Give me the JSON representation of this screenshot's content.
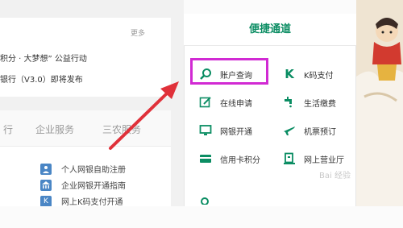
{
  "notice": {
    "more": "更多",
    "line1": "积分 · 大梦想” 公益行动",
    "line2": "银行（V3.0）即将发布"
  },
  "tabs": [
    "行",
    "企业服务",
    "三农服务"
  ],
  "services": [
    {
      "icon": "user-icon",
      "label": "个人网银自助注册"
    },
    {
      "icon": "bank-icon",
      "label": "企业网银开通指南"
    },
    {
      "icon": "k-icon",
      "label": "网上K码支付开通"
    }
  ],
  "quick": {
    "title": "便捷通道",
    "items": [
      {
        "icon": "search-icon",
        "label": "账户查询"
      },
      {
        "icon": "k-icon",
        "label": "K码支付"
      },
      {
        "icon": "edit-icon",
        "label": "在线申请"
      },
      {
        "icon": "faucet-icon",
        "label": "生活缴费"
      },
      {
        "icon": "monitor-icon",
        "label": "网银开通"
      },
      {
        "icon": "plane-icon",
        "label": "机票预订"
      },
      {
        "icon": "card-icon",
        "label": "信用卡积分"
      },
      {
        "icon": "office-icon",
        "label": "网上营业厅"
      }
    ]
  },
  "colors": {
    "accent": "#0b8d63",
    "highlight": "#d12ad3",
    "arrow": "#e0313a"
  },
  "watermark": "Bai 经验"
}
